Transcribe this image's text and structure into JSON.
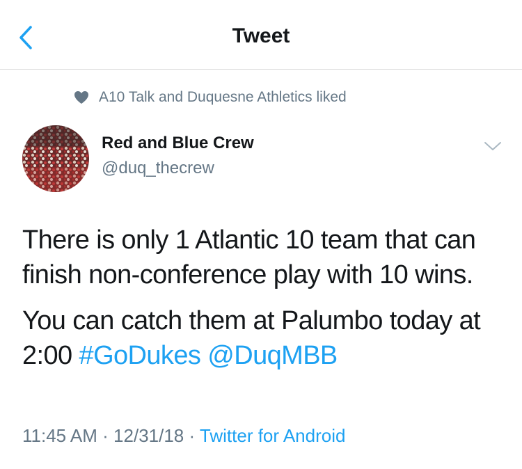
{
  "nav": {
    "title": "Tweet"
  },
  "social_context": {
    "text": "A10 Talk and Duquesne Athletics liked"
  },
  "author": {
    "name": "Red and Blue Crew",
    "handle": "@duq_thecrew"
  },
  "tweet": {
    "line1": "There is only 1 Atlantic 10 team that can finish non-conference play with 10 wins.",
    "line2_text": "You can catch them at Palumbo today at 2:00",
    "hashtag": "#GoDukes",
    "mention": "@DuqMBB"
  },
  "meta": {
    "time": "11:45 AM",
    "sep1": " · ",
    "date": "12/31/18",
    "sep2": " · ",
    "source": "Twitter for Android"
  },
  "colors": {
    "accent": "#1da1f2",
    "secondary_text": "#657786",
    "primary_text": "#14171a",
    "divider": "#d8d8d8"
  },
  "icons": {
    "back": "chevron-left-icon",
    "like": "heart-icon",
    "menu": "chevron-down-icon"
  }
}
